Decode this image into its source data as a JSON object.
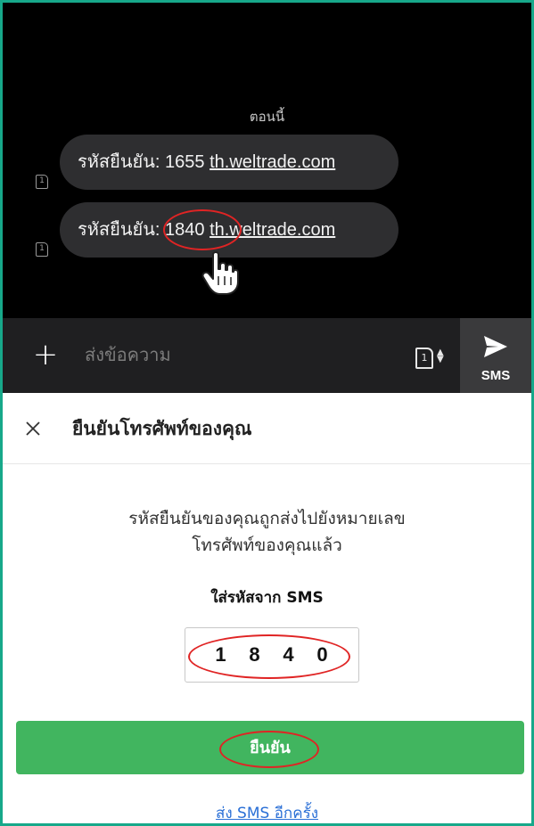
{
  "sms_app": {
    "timestamp": "ตอนนี้",
    "messages": [
      {
        "sim": "1",
        "prefix": "รหัสยืนยัน: ",
        "code": "1655",
        "link": "th.weltrade.com"
      },
      {
        "sim": "1",
        "prefix": "รหัสยืนยัน: ",
        "code": "1840",
        "link": "th.weltrade.com"
      }
    ],
    "input_placeholder": "ส่งข้อความ",
    "sim_switch": "1",
    "send_label": "SMS"
  },
  "modal": {
    "title": "ยืนยันโทรศัพท์ของคุณ",
    "description_line1": "รหัสยืนยันของคุณถูกส่งไปยังหมายเลข",
    "description_line2": "โทรศัพท์ของคุณแล้ว",
    "code_label": "ใส่รหัสจาก SMS",
    "code_digits": [
      "1",
      "8",
      "4",
      "0"
    ],
    "confirm_label": "ยืนยัน",
    "resend_label": "ส่ง SMS อีกครั้ง"
  },
  "colors": {
    "frame_border": "#17a88a",
    "confirm_button": "#41b55f",
    "highlight": "#e02424",
    "link": "#2a6fd6"
  }
}
